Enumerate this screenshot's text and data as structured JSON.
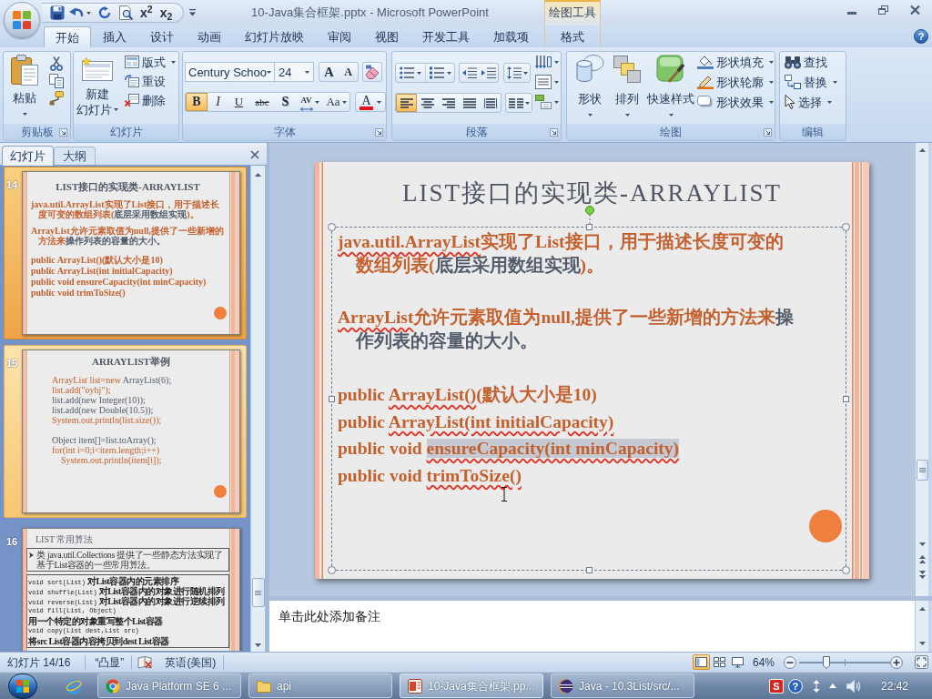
{
  "window": {
    "title": "10-Java集合框架.pptx - Microsoft PowerPoint",
    "contextual_group": "绘图工具",
    "superscript": "x$^{2}$",
    "subscript": "x$_{2}$",
    "help": "?"
  },
  "tabs": [
    {
      "label": "开始",
      "kind": "standard",
      "selected": true
    },
    {
      "label": "插入",
      "kind": "standard",
      "selected": false
    },
    {
      "label": "设计",
      "kind": "standard",
      "selected": false
    },
    {
      "label": "动画",
      "kind": "standard",
      "selected": false
    },
    {
      "label": "幻灯片放映",
      "kind": "standard",
      "selected": false
    },
    {
      "label": "审阅",
      "kind": "standard",
      "selected": false
    },
    {
      "label": "视图",
      "kind": "standard",
      "selected": false
    },
    {
      "label": "开发工具",
      "kind": "standard",
      "selected": false
    },
    {
      "label": "加载项",
      "kind": "standard",
      "selected": false
    },
    {
      "label": "格式",
      "kind": "contextual",
      "selected": false
    }
  ],
  "ribbon": {
    "clipboard": {
      "label": "剪贴板",
      "paste": "粘贴"
    },
    "slides": {
      "label": "幻灯片",
      "new_slide": [
        "新建",
        "幻灯片"
      ],
      "layout": "版式",
      "reset": "重设",
      "delete": "删除"
    },
    "font": {
      "label": "字体",
      "font_name": "Century Schoo",
      "font_size": "24",
      "grow": "A",
      "shrink": "A",
      "styles": [
        {
          "label": "B",
          "kind": "bold",
          "on": true
        },
        {
          "label": "I",
          "kind": "italic",
          "on": false
        },
        {
          "label": "U",
          "kind": "underline",
          "on": false
        },
        {
          "label": "abc",
          "kind": "strikethrough",
          "on": false
        },
        {
          "label": "S",
          "kind": "shadow",
          "on": false
        },
        {
          "label": "AV",
          "kind": "spacing",
          "on": false
        },
        {
          "label": "Aa",
          "kind": "case",
          "on": false
        }
      ],
      "font_color": "A"
    },
    "paragraph": {
      "label": "段落",
      "alignment": [
        {
          "kind": "left",
          "selected": true
        },
        {
          "kind": "center",
          "selected": false
        },
        {
          "kind": "right",
          "selected": false
        },
        {
          "kind": "justify",
          "selected": false
        },
        {
          "kind": "distributed",
          "selected": false
        }
      ]
    },
    "drawing": {
      "label": "绘图",
      "shapes": "形状",
      "arrange": "排列",
      "quick_styles": "快速样式",
      "fill": "形状填充",
      "outline": "形状轮廓",
      "effects": "形状效果"
    },
    "editing": {
      "label": "编辑",
      "find": "查找",
      "replace": "替换",
      "select": "选择"
    }
  },
  "slide_pane": {
    "tabs": [
      {
        "label": "幻灯片",
        "selected": true
      },
      {
        "label": "大纲",
        "selected": false
      }
    ],
    "thumbnails": [
      {
        "number": "14",
        "kind": "text",
        "selected": true,
        "hovered": false,
        "title": "LIST接口的实现类-ARRAYLIST",
        "paragraphs": [
          [
            {
              "text": "java.util.ArrayList实现了List接口，用于描述长度可变的数组列表(",
              "accent": true
            },
            {
              "text": "底层采用数组实现",
              "accent": false
            },
            {
              "text": ")。",
              "accent": true
            }
          ],
          [
            {
              "text": "ArrayList允许元素取值为null,提供了一些新增的方法来",
              "accent": true
            },
            {
              "text": "操作列表的容量的大小。",
              "accent": false
            }
          ]
        ],
        "code_lines": [
          [
            {
              "text": "public ArrayList()(默认大小是10)",
              "accent": true
            }
          ],
          [
            {
              "text": "public ArrayList(int initialCapacity)",
              "accent": true
            }
          ],
          [
            {
              "text": "public void ensureCapacity(int minCapacity)",
              "accent": true
            }
          ],
          [
            {
              "text": "public void trimToSize()",
              "accent": true
            }
          ]
        ]
      },
      {
        "number": "15",
        "kind": "code",
        "selected": false,
        "hovered": true,
        "title": "ARRAYLIST举例",
        "blocks": [
          [
            {
              "segments": [
                {
                  "text": "ArrayList list=new",
                  "accent": true
                },
                {
                  "text": " ArrayList(6);",
                  "accent": false
                }
              ]
            },
            {
              "segments": [
                {
                  "text": "list.add(\"oyhj\");",
                  "accent": true
                }
              ]
            },
            {
              "segments": [
                {
                  "text": "list.add(new Integer(10));",
                  "accent": false
                }
              ]
            },
            {
              "segments": [
                {
                  "text": "list.add(new Double(10.5));",
                  "accent": false
                }
              ]
            },
            {
              "segments": [
                {
                  "text": "System.out.println(list.size());",
                  "accent": true
                }
              ]
            }
          ],
          [
            {
              "segments": [
                {
                  "text": "Object item[]=list.toArray();",
                  "accent": false
                }
              ]
            },
            {
              "segments": [
                {
                  "text": "for(int i=0;i<item.length;i++)",
                  "accent": true
                }
              ],
              "children": [
                {
                  "segments": [
                    {
                      "text": "System.out.println(item[i]);",
                      "accent": true
                    }
                  ]
                }
              ]
            }
          ]
        ]
      },
      {
        "number": "16",
        "kind": "list",
        "selected": false,
        "hovered": false,
        "title": "LIST 常用算法",
        "intro": "类 java.util.Collections 提供了一些静态方法实现了基于List容器的一些常用算法。",
        "rows": [
          {
            "code": "void sort(List)",
            "description": "对List容器内的元素排序"
          },
          {
            "code": "void shuffle(List)",
            "description": "对List容器内的对象进行随机排列"
          },
          {
            "code": "void reverse(List)",
            "description": "对List容器内的对象进行逆续排列"
          },
          {
            "code": "void fill(List, Object)"
          },
          {
            "description": "用一个特定的对象重写整个List容器"
          },
          {
            "code": "void copy(List dest,List src)"
          },
          {
            "description": "将src List容器内容拷贝到dest List容器"
          }
        ]
      }
    ]
  },
  "slide": {
    "title": "LIST接口的实现类-ARRAYLIST",
    "paragraphs": [
      [
        {
          "text": "java.util.ArrayList",
          "accent": true,
          "misspelled": true,
          "selected": false
        },
        {
          "text": "实现了List接口，用于描述长度可变的数组列表(",
          "accent": true,
          "misspelled": false,
          "selected": false
        },
        {
          "text": "底层采用数组实现",
          "accent": false,
          "misspelled": false,
          "selected": false
        },
        {
          "text": ")。",
          "accent": true,
          "misspelled": false,
          "selected": false
        }
      ],
      [
        {
          "text": "ArrayList",
          "accent": true,
          "misspelled": true,
          "selected": false
        },
        {
          "text": "允许元素取值为null,提供了一些新增的方法来",
          "accent": true,
          "misspelled": false,
          "selected": false
        },
        {
          "text": "操作列表的容量的大小。",
          "accent": false,
          "misspelled": false,
          "selected": false
        }
      ]
    ],
    "code_lines": [
      [
        {
          "text": "public ",
          "accent": true,
          "misspelled": false,
          "selected": false
        },
        {
          "text": "ArrayList()",
          "accent": true,
          "misspelled": true,
          "selected": false
        },
        {
          "text": "(默认大小是10)",
          "accent": true,
          "misspelled": false,
          "selected": false
        }
      ],
      [
        {
          "text": "public ",
          "accent": true,
          "misspelled": false,
          "selected": false
        },
        {
          "text": "ArrayList(int initialCapacity)",
          "accent": true,
          "misspelled": true,
          "selected": false
        }
      ],
      [
        {
          "text": "public void ",
          "accent": true,
          "misspelled": false,
          "selected": false
        },
        {
          "text": "ensureCapacity(int minCapacity)",
          "accent": true,
          "misspelled": true,
          "selected": true
        }
      ],
      [
        {
          "text": "public void ",
          "accent": true,
          "misspelled": false,
          "selected": false
        },
        {
          "text": "trimToSize()",
          "accent": true,
          "misspelled": true,
          "selected": false
        }
      ]
    ]
  },
  "notes": {
    "placeholder": "单击此处添加备注"
  },
  "status_bar": {
    "slide": "幻灯片 14/16",
    "theme": "“凸显”",
    "language": "英语(美国)",
    "views": [
      {
        "kind": "normal",
        "selected": true
      },
      {
        "kind": "sorter",
        "selected": false
      },
      {
        "kind": "slideshow",
        "selected": false
      }
    ],
    "zoom": "64%",
    "zoom_slider": {
      "level": 0.3
    }
  },
  "taskbar": {
    "tasks": [
      {
        "label": "Java Platform SE 6 ...",
        "kind": "browser",
        "selected": false
      },
      {
        "label": "api",
        "kind": "folder",
        "selected": false
      },
      {
        "label": "10-Java集合框架.pp...",
        "kind": "presentation",
        "selected": true
      },
      {
        "label": "Java - 10.3List/src/...",
        "kind": "ide",
        "selected": false
      }
    ],
    "tray": {
      "input_method": "S",
      "help": "?"
    },
    "clock": "22:42"
  }
}
